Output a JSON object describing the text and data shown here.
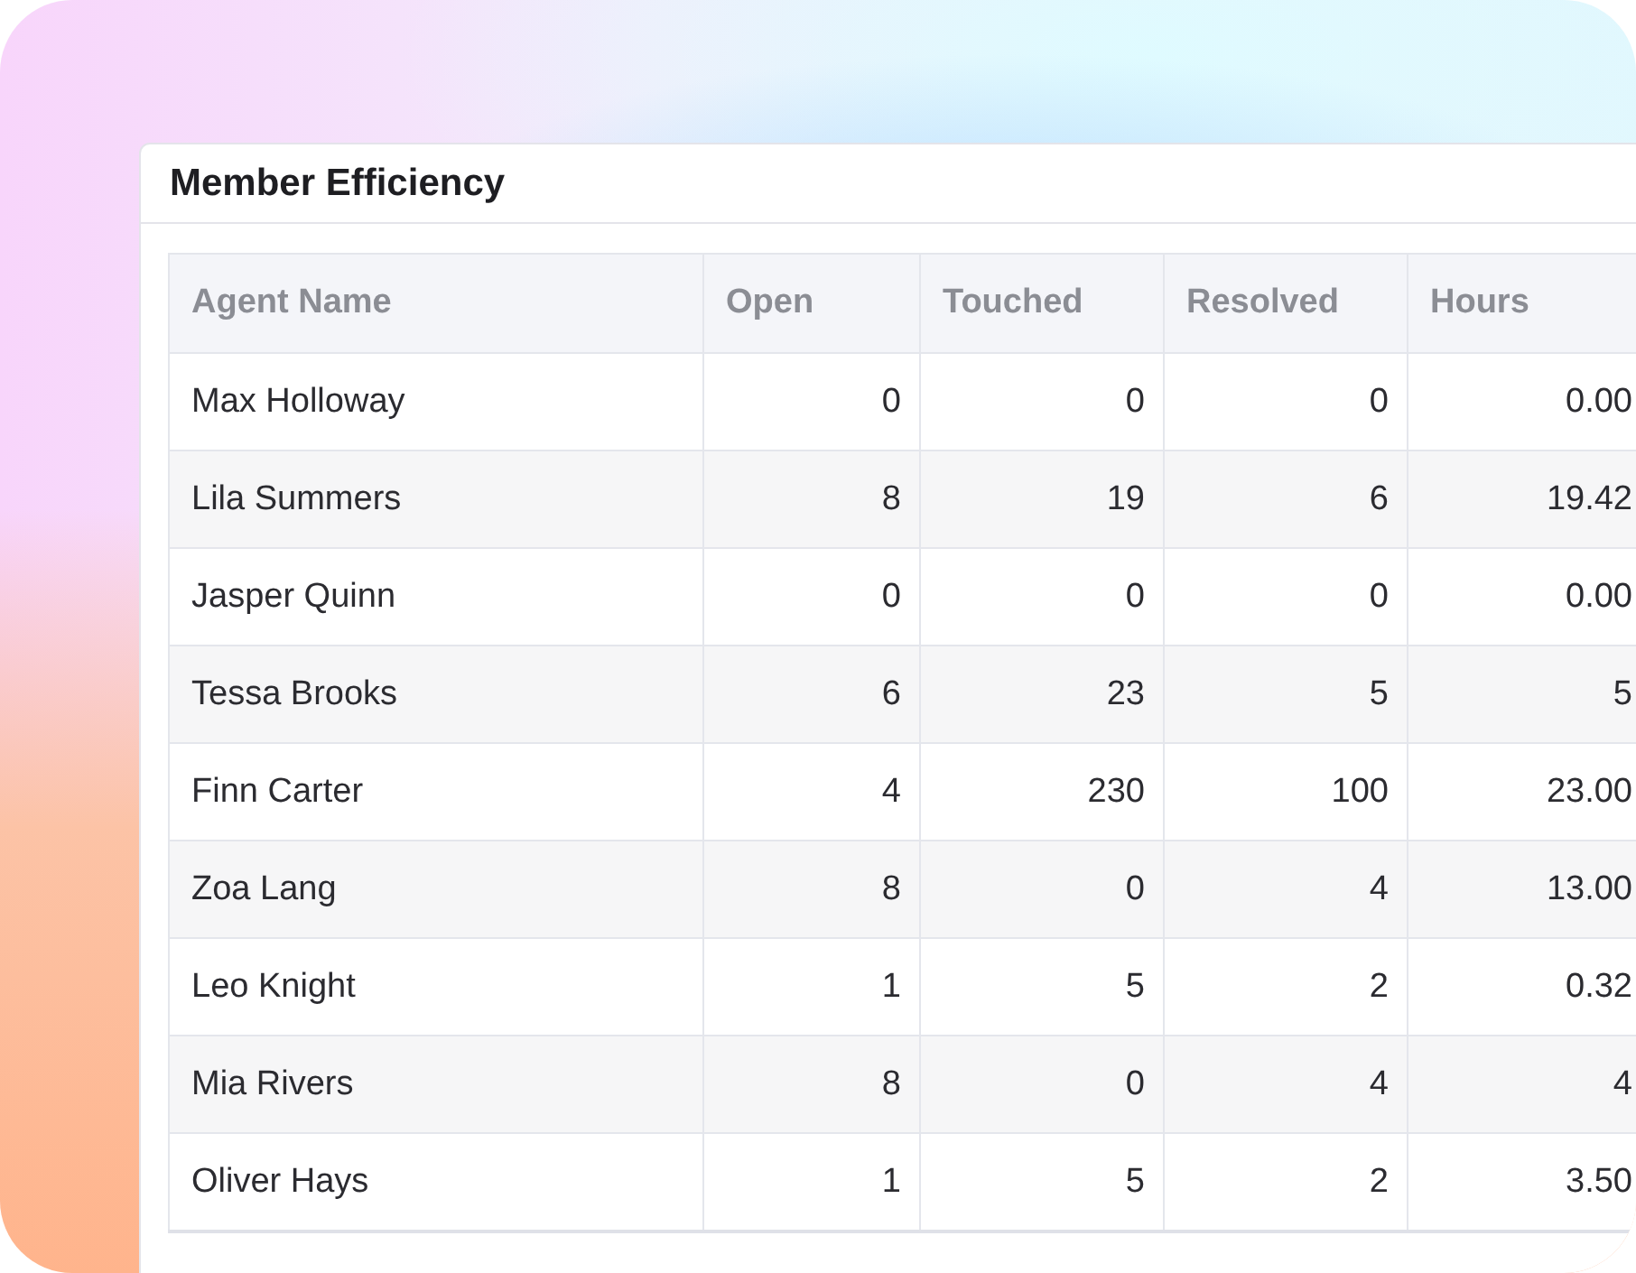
{
  "card": {
    "title": "Member Efficiency"
  },
  "table": {
    "columns": [
      "Agent Name",
      "Open",
      "Touched",
      "Resolved",
      "Hours"
    ],
    "rows": [
      [
        "Max Holloway",
        "0",
        "0",
        "0",
        "0.00"
      ],
      [
        "Lila Summers",
        "8",
        "19",
        "6",
        "19.42"
      ],
      [
        "Jasper Quinn",
        "0",
        "0",
        "0",
        "0.00"
      ],
      [
        "Tessa Brooks",
        "6",
        "23",
        "5",
        "5"
      ],
      [
        "Finn Carter",
        "4",
        "230",
        "100",
        "23.00"
      ],
      [
        "Zoa Lang",
        "8",
        "0",
        "4",
        "13.00"
      ],
      [
        "Leo Knight",
        "1",
        "5",
        "2",
        "0.32"
      ],
      [
        "Mia Rivers",
        "8",
        "0",
        "4",
        "4"
      ],
      [
        "Oliver Hays",
        "1",
        "5",
        "2",
        "3.50"
      ]
    ]
  }
}
